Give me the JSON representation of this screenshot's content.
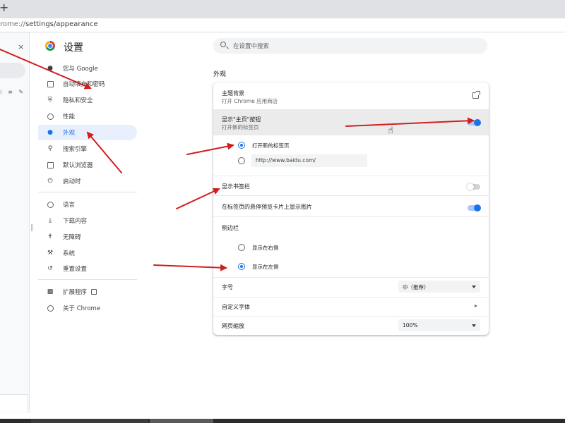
{
  "browser": {
    "new_tab_glyph": "+",
    "url_host": "rome://",
    "url_path": "settings/appearance"
  },
  "sidepanel": {
    "close_glyph": "×",
    "tools_glyphs": "⁞ ≡ ✎"
  },
  "header": {
    "title": "设置",
    "search_placeholder": "在设置中搜索"
  },
  "nav": {
    "items": [
      {
        "label": "您与 Google",
        "icon": "person-icon"
      },
      {
        "label": "自动填充和密码",
        "icon": "clipboard-icon"
      },
      {
        "label": "隐私和安全",
        "icon": "shield-icon"
      },
      {
        "label": "性能",
        "icon": "speedometer-icon"
      },
      {
        "label": "外观",
        "icon": "palette-icon",
        "active": true
      },
      {
        "label": "搜索引擎",
        "icon": "search-icon"
      },
      {
        "label": "默认浏览器",
        "icon": "browser-icon"
      },
      {
        "label": "启动时",
        "icon": "power-icon"
      },
      {
        "label": "语言",
        "icon": "globe-icon"
      },
      {
        "label": "下载内容",
        "icon": "download-icon"
      },
      {
        "label": "无障碍",
        "icon": "accessibility-icon"
      },
      {
        "label": "系统",
        "icon": "wrench-icon"
      },
      {
        "label": "重置设置",
        "icon": "reset-icon"
      },
      {
        "label": "扩展程序",
        "icon": "puzzle-icon"
      },
      {
        "label": "关于 Chrome",
        "icon": "chrome-icon"
      }
    ]
  },
  "appearance": {
    "section_title": "外观",
    "theme": {
      "label": "主题背景",
      "sub": "打开 Chrome 应用商店"
    },
    "home_button": {
      "label": "显示\"主页\"按钮",
      "sub": "打开新的标签页",
      "on": true
    },
    "home_options": [
      {
        "label": "打开新的标签页",
        "checked": true
      },
      {
        "value": "http://www.baidu.com/",
        "checked": false
      }
    ],
    "bookmarks_bar": {
      "label": "显示书签栏",
      "on": false
    },
    "tab_hover": {
      "label": "在标签页的悬停预览卡片上显示图片",
      "on": true
    },
    "side_panel": {
      "label": "侧边栏",
      "options": [
        {
          "label": "显示在右侧",
          "checked": false
        },
        {
          "label": "显示在左侧",
          "checked": true
        }
      ]
    },
    "font_size": {
      "label": "字号",
      "value": "中（推荐）"
    },
    "custom_fonts": {
      "label": "自定义字体",
      "chevron": "▸"
    },
    "page_zoom": {
      "label": "网页缩放",
      "value": "100%"
    }
  },
  "colors": {
    "accent": "#1a73e8",
    "active_nav_bg": "#e8f0fe",
    "annotation_arrow": "#d11f1f"
  }
}
